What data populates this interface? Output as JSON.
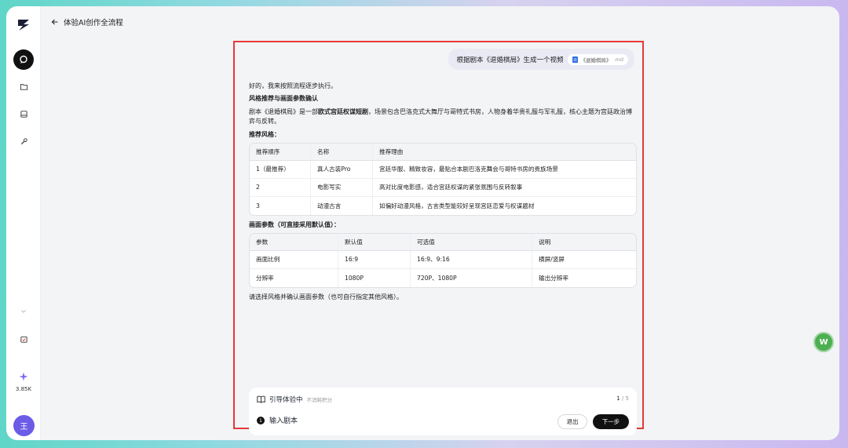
{
  "header": {
    "back_label": "体验AI创作全流程"
  },
  "sidebar": {
    "credits": "3.85K",
    "avatar_initial": "王"
  },
  "chat": {
    "user_message": "根据剧本《退婚棋局》生成一个视频",
    "file_name": "《退婚棋局》",
    "file_ext": ".md",
    "reply": {
      "intro": "好的，我来按照流程逐步执行。",
      "section_title": "风格推荐与画面参数确认",
      "desc_prefix": "剧本《退婚棋局》是一部",
      "desc_bold": "欧式宫廷权谋短剧",
      "desc_suffix": "，场景包含巴洛克式大舞厅与哥特式书房，人物身着华贵礼服与军礼服，核心主题为宫廷政治博弈与反转。",
      "style_heading": "推荐风格：",
      "style_table": {
        "headers": [
          "推荐顺序",
          "名称",
          "推荐理由"
        ],
        "rows": [
          [
            "1（最推荐）",
            "真人古装Pro",
            "宫廷华服、精致妆容，最贴合本剧巴洛克舞会与哥特书房的贵族场景"
          ],
          [
            "2",
            "电影写实",
            "高对比度电影感，适合宫廷权谋的紧张氛围与反转叙事"
          ],
          [
            "3",
            "动漫古言",
            "如偏好动漫风格，古言类型能较好呈现宫廷恋爱与权谋题材"
          ]
        ]
      },
      "param_heading": "画面参数（可直接采用默认值）：",
      "param_table": {
        "headers": [
          "参数",
          "默认值",
          "可选值",
          "说明"
        ],
        "rows": [
          [
            "画面比例",
            "16:9",
            "16:9、9:16",
            "横屏/竖屏"
          ],
          [
            "分辨率",
            "1080P",
            "720P、1080P",
            "输出分辨率"
          ]
        ]
      },
      "closing": "请选择风格并确认画面参数（也可自行指定其他风格）。"
    }
  },
  "guide": {
    "title": "引导体验中",
    "subtitle": "不消耗积分",
    "page_current": "1",
    "page_total": "/ 5",
    "step_number": "1",
    "step_label": "输入剧本",
    "exit_label": "退出",
    "next_label": "下一步"
  },
  "floating": {
    "label": "W"
  },
  "colors": {
    "accent_red": "#e53935",
    "primary_black": "#111111",
    "avatar_purple": "#6b5ce7",
    "float_green": "#4caf50"
  }
}
